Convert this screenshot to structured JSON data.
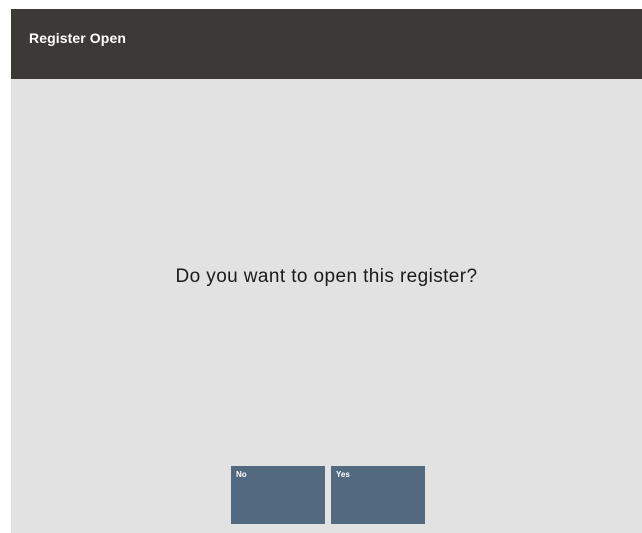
{
  "dialog": {
    "title": "Register Open",
    "prompt": "Do you want to open this register?"
  },
  "buttons": {
    "no_label": "No",
    "yes_label": "Yes"
  },
  "colors": {
    "title_bar": "#3c3a37",
    "background": "#e2e2e2",
    "button": "#536980",
    "button_text": "#ffffff"
  }
}
